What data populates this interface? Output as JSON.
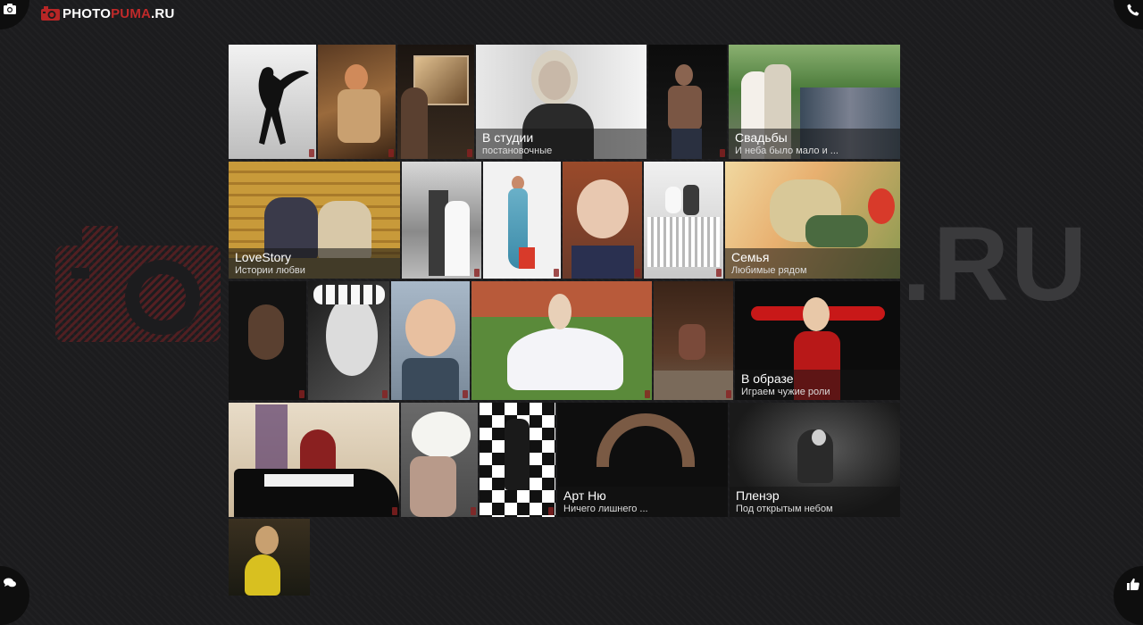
{
  "header": {
    "logo": {
      "photo": "PHOTO",
      "puma": "PUMA",
      "ru": ".RU"
    },
    "camera_button_icon": "camera-icon",
    "phone_button_icon": "phone-icon"
  },
  "footer": {
    "chat_button_icon": "chat-icon",
    "like_button_icon": "thumbs-up-icon"
  },
  "watermark": {
    "right_text": ".RU"
  },
  "colors": {
    "background": "#1c1c1e",
    "brand_red": "#c02a2a",
    "caption_bg": "rgba(20,20,20,0.55)"
  },
  "categories": [
    {
      "title": "В студии",
      "subtitle": "постановочные"
    },
    {
      "title": "Свадьбы",
      "subtitle": "И неба было мало и ..."
    },
    {
      "title": "LoveStory",
      "subtitle": "Истории любви"
    },
    {
      "title": "Семья",
      "subtitle": "Любимые рядом"
    },
    {
      "title": "В образе",
      "subtitle": "Играем чужие роли"
    },
    {
      "title": "Арт Ню",
      "subtitle": "Ничего лишнего ..."
    },
    {
      "title": "Пленэр",
      "subtitle": "Под открытым небом"
    }
  ]
}
